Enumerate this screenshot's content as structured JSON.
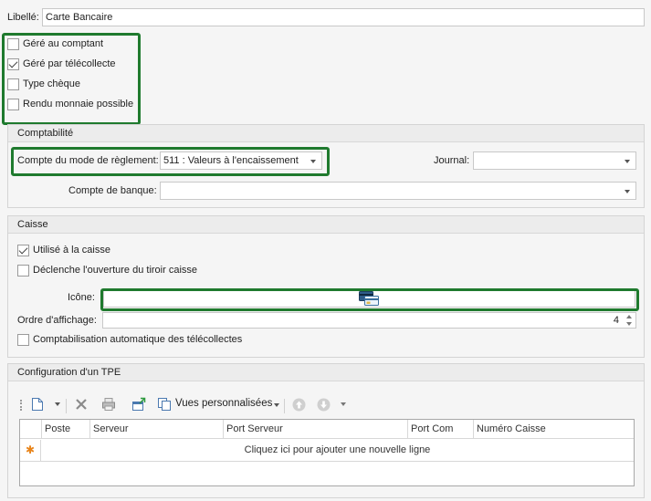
{
  "top": {
    "libelle_label": "Libellé:",
    "libelle_value": "Carte Bancaire"
  },
  "options": [
    {
      "label": "Géré au comptant",
      "checked": false
    },
    {
      "label": "Géré par télécollecte",
      "checked": true
    },
    {
      "label": "Type chèque",
      "checked": false
    },
    {
      "label": "Rendu monnaie possible",
      "checked": false
    }
  ],
  "comptabilite": {
    "title": "Comptabilité",
    "compte_label": "Compte du mode de règlement:",
    "compte_value": "511 : Valeurs à l'encaissement",
    "journal_label": "Journal:",
    "journal_value": "",
    "banque_label": "Compte de banque:",
    "banque_value": ""
  },
  "caisse": {
    "title": "Caisse",
    "utilise_label": "Utilisé à la caisse",
    "utilise_checked": true,
    "tiroir_label": "Déclenche l'ouverture du tiroir caisse",
    "tiroir_checked": false,
    "icone_label": "Icône:",
    "icone_name": "credit-card-icon",
    "ordre_label": "Ordre d'affichage:",
    "ordre_value": "4",
    "auto_label": "Comptabilisation automatique des télécollectes",
    "auto_checked": false
  },
  "tpe": {
    "title": "Configuration d'un TPE",
    "toolbar": {
      "views_label": "Vues personnalisées"
    },
    "columns": [
      "Poste",
      "Serveur",
      "Port Serveur",
      "Port Com",
      "Numéro Caisse"
    ],
    "new_row_text": "Cliquez ici pour ajouter une nouvelle ligne"
  },
  "colors": {
    "highlight": "#1f7a2e",
    "group_header": "#ececec"
  }
}
